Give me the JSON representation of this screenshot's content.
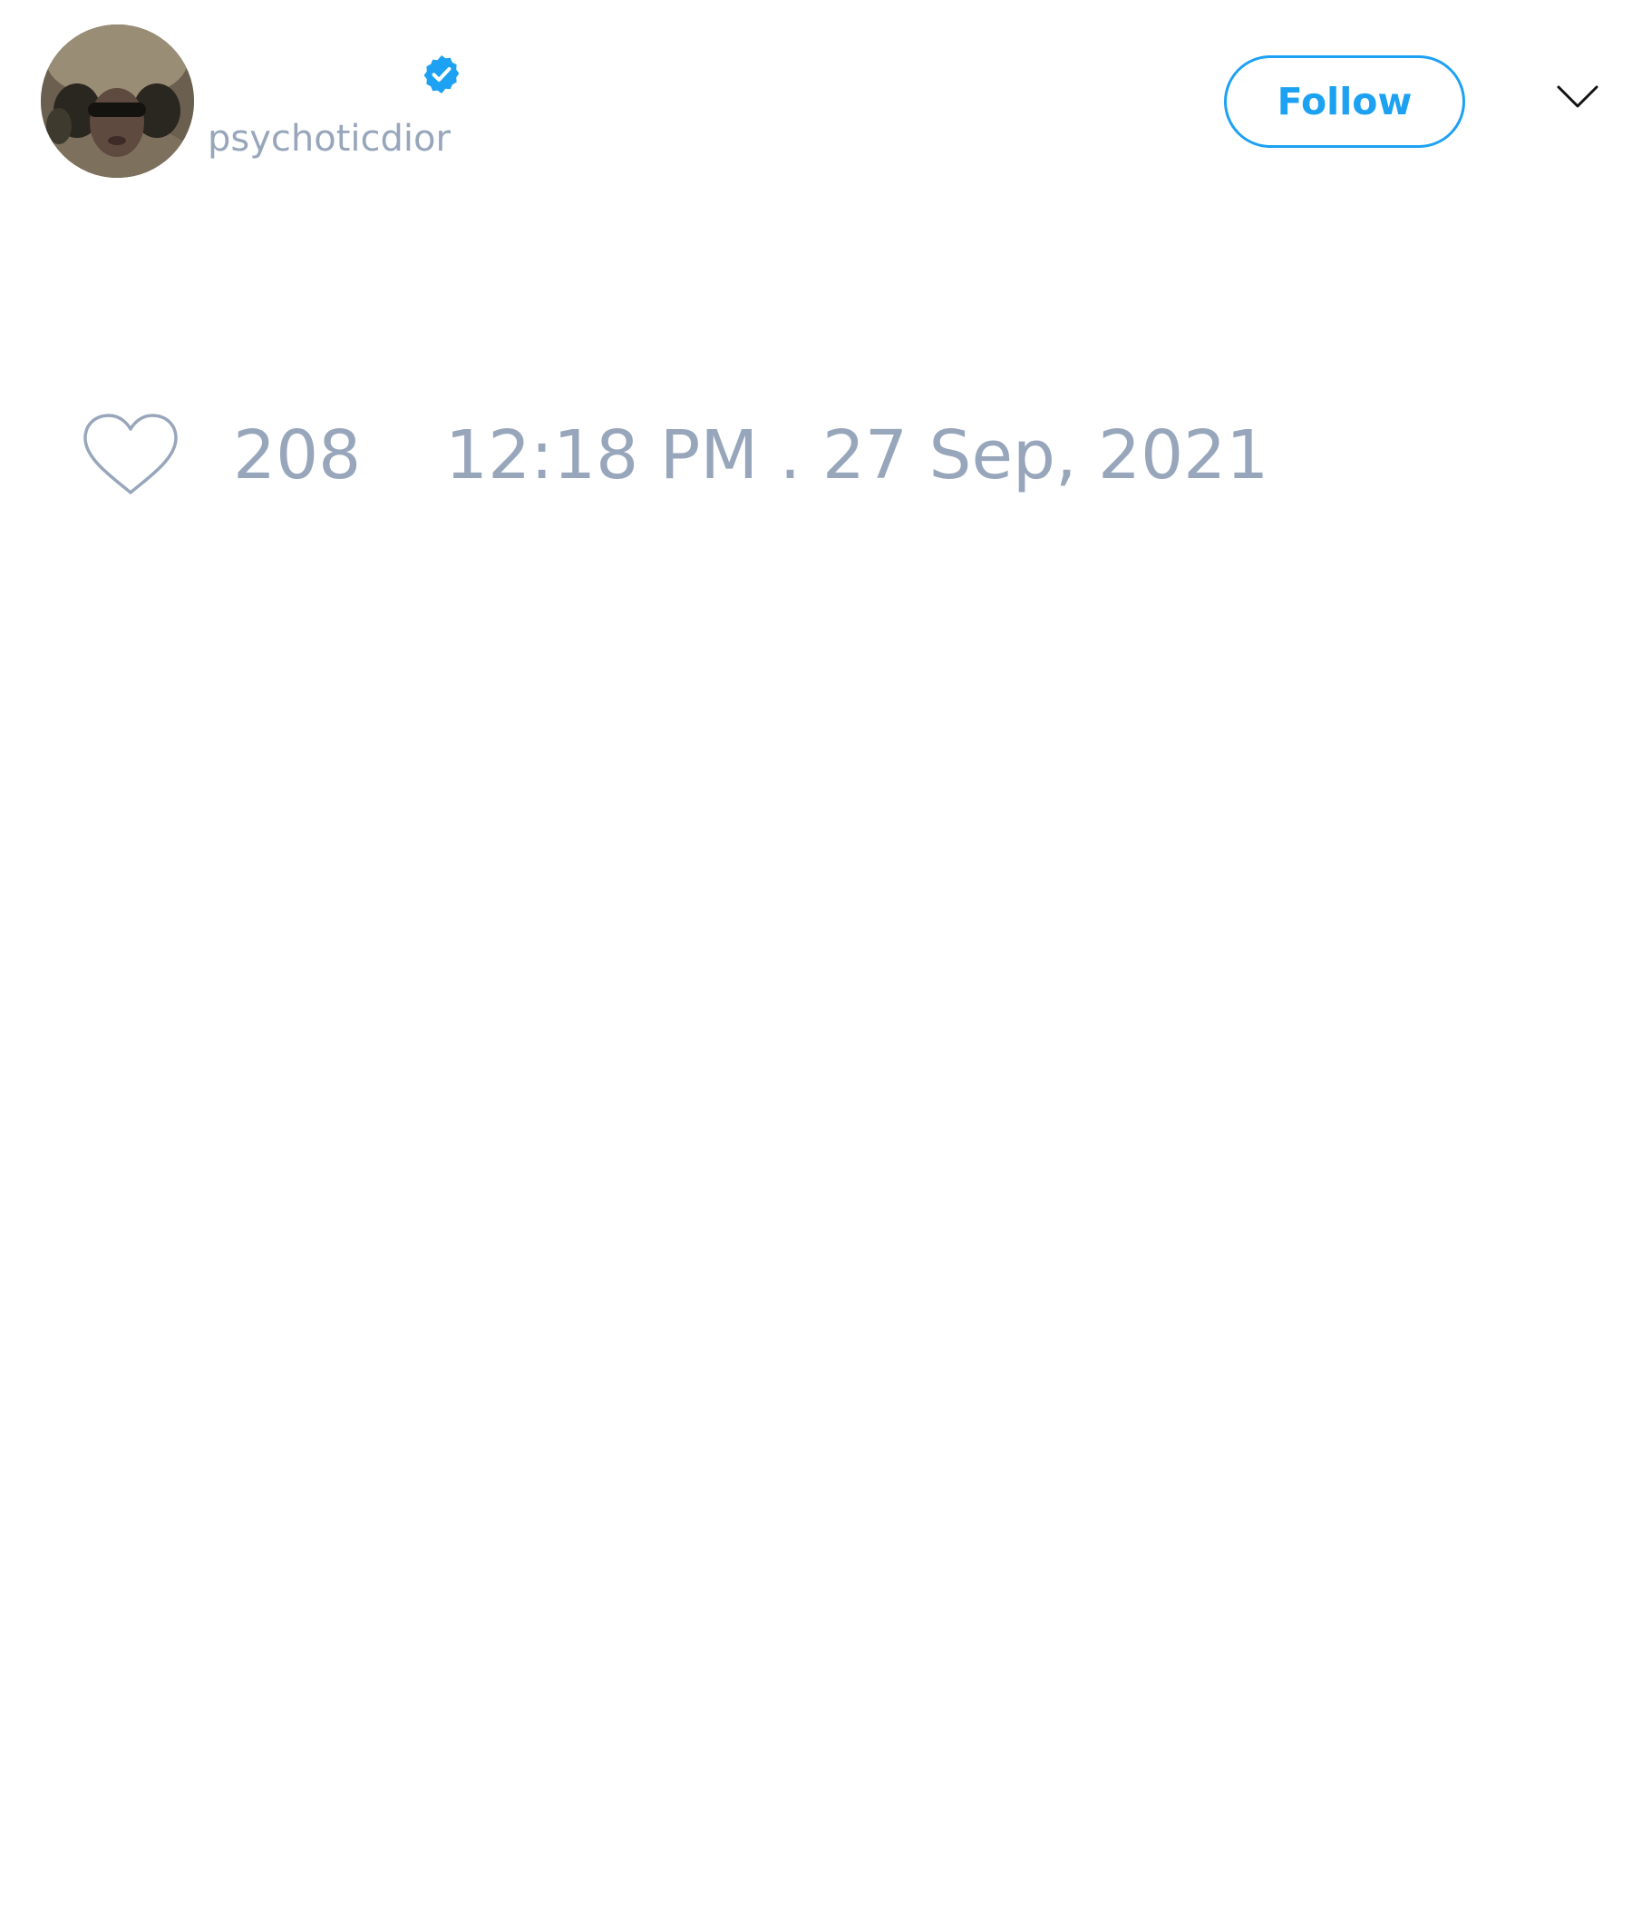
{
  "author": {
    "handle": "psychoticdior",
    "verified": true,
    "avatar_icon": "profile-photo"
  },
  "actions": {
    "follow_label": "Follow",
    "menu_icon": "chevron-down-icon"
  },
  "stats": {
    "like_icon": "heart-outline-icon",
    "like_count": "208",
    "timestamp": "12:18 PM . 27 Sep, 2021"
  },
  "colors": {
    "accent": "#1da1f2",
    "muted_text": "#98a6bb",
    "background": "#ffffff"
  }
}
